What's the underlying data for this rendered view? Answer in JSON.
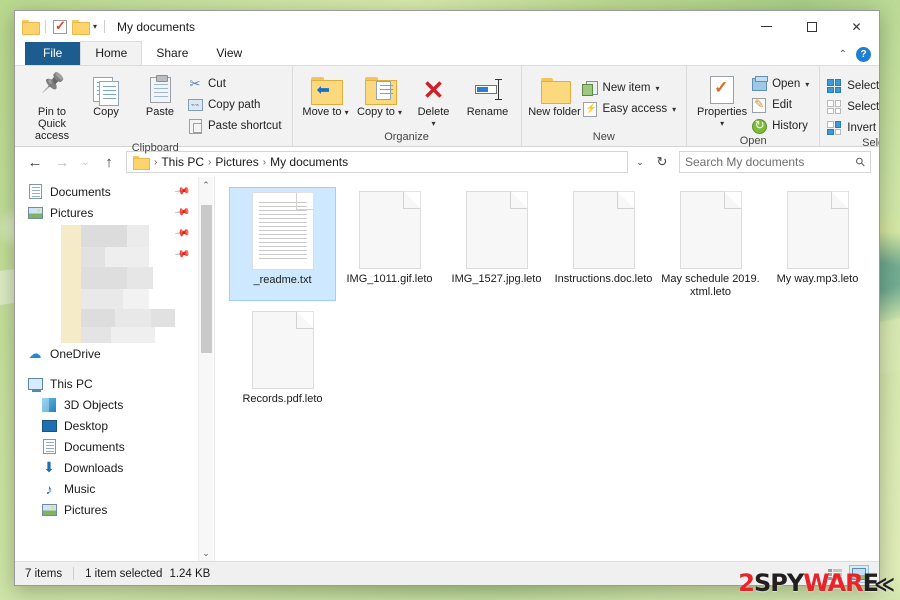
{
  "window": {
    "title": "My documents",
    "quick_access": [
      "folder-icon",
      "checkbox-icon",
      "folder-icon",
      "dropdown-caret"
    ],
    "controls": {
      "minimize": "minimize-icon",
      "maximize": "maximize-icon",
      "close": "close-icon"
    }
  },
  "ribbon": {
    "tabs": [
      {
        "label": "File",
        "active": false,
        "style": "file"
      },
      {
        "label": "Home",
        "active": true
      },
      {
        "label": "Share",
        "active": false
      },
      {
        "label": "View",
        "active": false
      }
    ],
    "collapse_icon": "chevron-up-icon",
    "help_icon": "help-icon",
    "help_label": "?",
    "groups": [
      {
        "name": "Clipboard",
        "label": "Clipboard",
        "big_buttons": [
          {
            "label": "Pin to Quick access",
            "icon": "pin-icon"
          },
          {
            "label": "Copy",
            "icon": "copy-icon"
          },
          {
            "label": "Paste",
            "icon": "paste-icon"
          }
        ],
        "small_buttons": [
          {
            "label": "Cut",
            "icon": "scissors-icon"
          },
          {
            "label": "Copy path",
            "icon": "copy-path-icon"
          },
          {
            "label": "Paste shortcut",
            "icon": "paste-shortcut-icon"
          }
        ]
      },
      {
        "name": "Organize",
        "label": "Organize",
        "big_buttons": [
          {
            "label": "Move to",
            "icon": "move-to-icon",
            "caret": "▾"
          },
          {
            "label": "Copy to",
            "icon": "copy-to-icon",
            "caret": "▾"
          },
          {
            "label": "Delete",
            "icon": "delete-icon",
            "caret": "▾"
          },
          {
            "label": "Rename",
            "icon": "rename-icon"
          }
        ]
      },
      {
        "name": "New",
        "label": "New",
        "big_buttons": [
          {
            "label": "New folder",
            "icon": "new-folder-icon"
          }
        ],
        "small_buttons": [
          {
            "label": "New item",
            "icon": "new-item-icon",
            "caret": "▾"
          },
          {
            "label": "Easy access",
            "icon": "easy-access-icon",
            "caret": "▾"
          }
        ]
      },
      {
        "name": "Open",
        "label": "Open",
        "big_buttons": [
          {
            "label": "Properties",
            "icon": "properties-icon",
            "caret": "▾"
          }
        ],
        "small_buttons": [
          {
            "label": "Open",
            "icon": "open-icon",
            "caret": "▾"
          },
          {
            "label": "Edit",
            "icon": "edit-icon"
          },
          {
            "label": "History",
            "icon": "history-icon"
          }
        ]
      },
      {
        "name": "Select",
        "label": "Select",
        "small_buttons": [
          {
            "label": "Select all",
            "icon": "select-all-icon"
          },
          {
            "label": "Select none",
            "icon": "select-none-icon"
          },
          {
            "label": "Invert selection",
            "icon": "invert-selection-icon"
          }
        ]
      }
    ]
  },
  "addressbar": {
    "back_icon": "back-arrow-icon",
    "forward_icon": "forward-arrow-icon",
    "recent_icon": "chevron-down-icon",
    "up_icon": "up-arrow-icon",
    "folder_icon": "folder-icon",
    "breadcrumbs": [
      "This PC",
      "Pictures",
      "My documents"
    ],
    "separator": "›",
    "dropdown_icon": "chevron-down-icon",
    "refresh_icon": "refresh-icon",
    "search": {
      "placeholder": "Search My documents",
      "icon": "search-icon"
    }
  },
  "navpane": {
    "items": [
      {
        "label": "Documents",
        "icon": "document-icon",
        "pinned": true,
        "indent": false
      },
      {
        "label": "Pictures",
        "icon": "picture-icon",
        "pinned": true,
        "indent": false
      },
      {
        "label": "",
        "icon": "blurred",
        "pinned": true,
        "indent": false,
        "blurred": true
      },
      {
        "label": "",
        "icon": "blurred",
        "pinned": true,
        "indent": false,
        "blurred": true
      },
      {
        "label": "OneDrive",
        "icon": "cloud-icon",
        "pinned": false,
        "indent": false
      },
      {
        "label": "This PC",
        "icon": "computer-icon",
        "pinned": false,
        "indent": false
      },
      {
        "label": "3D Objects",
        "icon": "3d-objects-icon",
        "pinned": false,
        "indent": true
      },
      {
        "label": "Desktop",
        "icon": "desktop-icon",
        "pinned": false,
        "indent": true
      },
      {
        "label": "Documents",
        "icon": "document-icon",
        "pinned": false,
        "indent": true
      },
      {
        "label": "Downloads",
        "icon": "download-icon",
        "pinned": false,
        "indent": true
      },
      {
        "label": "Music",
        "icon": "music-icon",
        "pinned": false,
        "indent": true
      },
      {
        "label": "Pictures",
        "icon": "picture-icon",
        "pinned": false,
        "indent": true
      }
    ],
    "scroll_up_icon": "chevron-up-icon",
    "scroll_down_icon": "chevron-down-icon"
  },
  "files": [
    {
      "name": "_readme.txt",
      "type": "text",
      "selected": true
    },
    {
      "name": "IMG_1011.gif.leto",
      "type": "blank",
      "selected": false
    },
    {
      "name": "IMG_1527.jpg.leto",
      "type": "blank",
      "selected": false
    },
    {
      "name": "Instructions.doc.leto",
      "type": "blank",
      "selected": false
    },
    {
      "name": "May schedule 2019.xtml.leto",
      "type": "blank",
      "selected": false
    },
    {
      "name": "My way.mp3.leto",
      "type": "blank",
      "selected": false
    },
    {
      "name": "Records.pdf.leto",
      "type": "blank",
      "selected": false
    }
  ],
  "statusbar": {
    "item_count": "7 items",
    "selection": "1 item selected",
    "size": "1.24 KB",
    "view_details_icon": "details-view-icon",
    "view_large_icon": "large-icons-view-icon"
  },
  "watermark": {
    "part1": "2",
    "part2": "SPY",
    "part3": "WAR",
    "part4": "E",
    "arrow": "≪",
    "color_red": "#e8232a",
    "color_black": "#231f20"
  }
}
